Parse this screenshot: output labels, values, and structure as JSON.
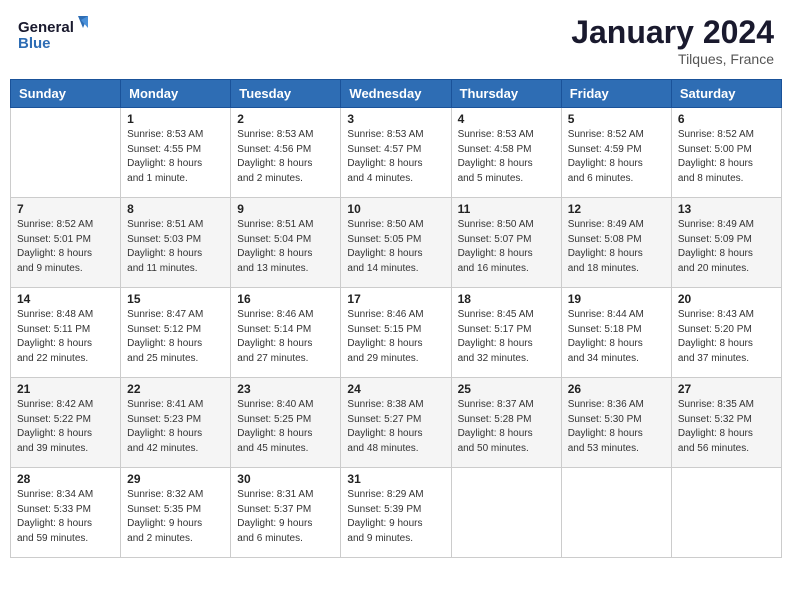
{
  "header": {
    "logo_line1": "General",
    "logo_line2": "Blue",
    "month": "January 2024",
    "location": "Tilques, France"
  },
  "columns": [
    "Sunday",
    "Monday",
    "Tuesday",
    "Wednesday",
    "Thursday",
    "Friday",
    "Saturday"
  ],
  "weeks": [
    [
      {
        "day": "",
        "sunrise": "",
        "sunset": "",
        "daylight": ""
      },
      {
        "day": "1",
        "sunrise": "Sunrise: 8:53 AM",
        "sunset": "Sunset: 4:55 PM",
        "daylight": "Daylight: 8 hours and 1 minute."
      },
      {
        "day": "2",
        "sunrise": "Sunrise: 8:53 AM",
        "sunset": "Sunset: 4:56 PM",
        "daylight": "Daylight: 8 hours and 2 minutes."
      },
      {
        "day": "3",
        "sunrise": "Sunrise: 8:53 AM",
        "sunset": "Sunset: 4:57 PM",
        "daylight": "Daylight: 8 hours and 4 minutes."
      },
      {
        "day": "4",
        "sunrise": "Sunrise: 8:53 AM",
        "sunset": "Sunset: 4:58 PM",
        "daylight": "Daylight: 8 hours and 5 minutes."
      },
      {
        "day": "5",
        "sunrise": "Sunrise: 8:52 AM",
        "sunset": "Sunset: 4:59 PM",
        "daylight": "Daylight: 8 hours and 6 minutes."
      },
      {
        "day": "6",
        "sunrise": "Sunrise: 8:52 AM",
        "sunset": "Sunset: 5:00 PM",
        "daylight": "Daylight: 8 hours and 8 minutes."
      }
    ],
    [
      {
        "day": "7",
        "sunrise": "Sunrise: 8:52 AM",
        "sunset": "Sunset: 5:01 PM",
        "daylight": "Daylight: 8 hours and 9 minutes."
      },
      {
        "day": "8",
        "sunrise": "Sunrise: 8:51 AM",
        "sunset": "Sunset: 5:03 PM",
        "daylight": "Daylight: 8 hours and 11 minutes."
      },
      {
        "day": "9",
        "sunrise": "Sunrise: 8:51 AM",
        "sunset": "Sunset: 5:04 PM",
        "daylight": "Daylight: 8 hours and 13 minutes."
      },
      {
        "day": "10",
        "sunrise": "Sunrise: 8:50 AM",
        "sunset": "Sunset: 5:05 PM",
        "daylight": "Daylight: 8 hours and 14 minutes."
      },
      {
        "day": "11",
        "sunrise": "Sunrise: 8:50 AM",
        "sunset": "Sunset: 5:07 PM",
        "daylight": "Daylight: 8 hours and 16 minutes."
      },
      {
        "day": "12",
        "sunrise": "Sunrise: 8:49 AM",
        "sunset": "Sunset: 5:08 PM",
        "daylight": "Daylight: 8 hours and 18 minutes."
      },
      {
        "day": "13",
        "sunrise": "Sunrise: 8:49 AM",
        "sunset": "Sunset: 5:09 PM",
        "daylight": "Daylight: 8 hours and 20 minutes."
      }
    ],
    [
      {
        "day": "14",
        "sunrise": "Sunrise: 8:48 AM",
        "sunset": "Sunset: 5:11 PM",
        "daylight": "Daylight: 8 hours and 22 minutes."
      },
      {
        "day": "15",
        "sunrise": "Sunrise: 8:47 AM",
        "sunset": "Sunset: 5:12 PM",
        "daylight": "Daylight: 8 hours and 25 minutes."
      },
      {
        "day": "16",
        "sunrise": "Sunrise: 8:46 AM",
        "sunset": "Sunset: 5:14 PM",
        "daylight": "Daylight: 8 hours and 27 minutes."
      },
      {
        "day": "17",
        "sunrise": "Sunrise: 8:46 AM",
        "sunset": "Sunset: 5:15 PM",
        "daylight": "Daylight: 8 hours and 29 minutes."
      },
      {
        "day": "18",
        "sunrise": "Sunrise: 8:45 AM",
        "sunset": "Sunset: 5:17 PM",
        "daylight": "Daylight: 8 hours and 32 minutes."
      },
      {
        "day": "19",
        "sunrise": "Sunrise: 8:44 AM",
        "sunset": "Sunset: 5:18 PM",
        "daylight": "Daylight: 8 hours and 34 minutes."
      },
      {
        "day": "20",
        "sunrise": "Sunrise: 8:43 AM",
        "sunset": "Sunset: 5:20 PM",
        "daylight": "Daylight: 8 hours and 37 minutes."
      }
    ],
    [
      {
        "day": "21",
        "sunrise": "Sunrise: 8:42 AM",
        "sunset": "Sunset: 5:22 PM",
        "daylight": "Daylight: 8 hours and 39 minutes."
      },
      {
        "day": "22",
        "sunrise": "Sunrise: 8:41 AM",
        "sunset": "Sunset: 5:23 PM",
        "daylight": "Daylight: 8 hours and 42 minutes."
      },
      {
        "day": "23",
        "sunrise": "Sunrise: 8:40 AM",
        "sunset": "Sunset: 5:25 PM",
        "daylight": "Daylight: 8 hours and 45 minutes."
      },
      {
        "day": "24",
        "sunrise": "Sunrise: 8:38 AM",
        "sunset": "Sunset: 5:27 PM",
        "daylight": "Daylight: 8 hours and 48 minutes."
      },
      {
        "day": "25",
        "sunrise": "Sunrise: 8:37 AM",
        "sunset": "Sunset: 5:28 PM",
        "daylight": "Daylight: 8 hours and 50 minutes."
      },
      {
        "day": "26",
        "sunrise": "Sunrise: 8:36 AM",
        "sunset": "Sunset: 5:30 PM",
        "daylight": "Daylight: 8 hours and 53 minutes."
      },
      {
        "day": "27",
        "sunrise": "Sunrise: 8:35 AM",
        "sunset": "Sunset: 5:32 PM",
        "daylight": "Daylight: 8 hours and 56 minutes."
      }
    ],
    [
      {
        "day": "28",
        "sunrise": "Sunrise: 8:34 AM",
        "sunset": "Sunset: 5:33 PM",
        "daylight": "Daylight: 8 hours and 59 minutes."
      },
      {
        "day": "29",
        "sunrise": "Sunrise: 8:32 AM",
        "sunset": "Sunset: 5:35 PM",
        "daylight": "Daylight: 9 hours and 2 minutes."
      },
      {
        "day": "30",
        "sunrise": "Sunrise: 8:31 AM",
        "sunset": "Sunset: 5:37 PM",
        "daylight": "Daylight: 9 hours and 6 minutes."
      },
      {
        "day": "31",
        "sunrise": "Sunrise: 8:29 AM",
        "sunset": "Sunset: 5:39 PM",
        "daylight": "Daylight: 9 hours and 9 minutes."
      },
      {
        "day": "",
        "sunrise": "",
        "sunset": "",
        "daylight": ""
      },
      {
        "day": "",
        "sunrise": "",
        "sunset": "",
        "daylight": ""
      },
      {
        "day": "",
        "sunrise": "",
        "sunset": "",
        "daylight": ""
      }
    ]
  ]
}
